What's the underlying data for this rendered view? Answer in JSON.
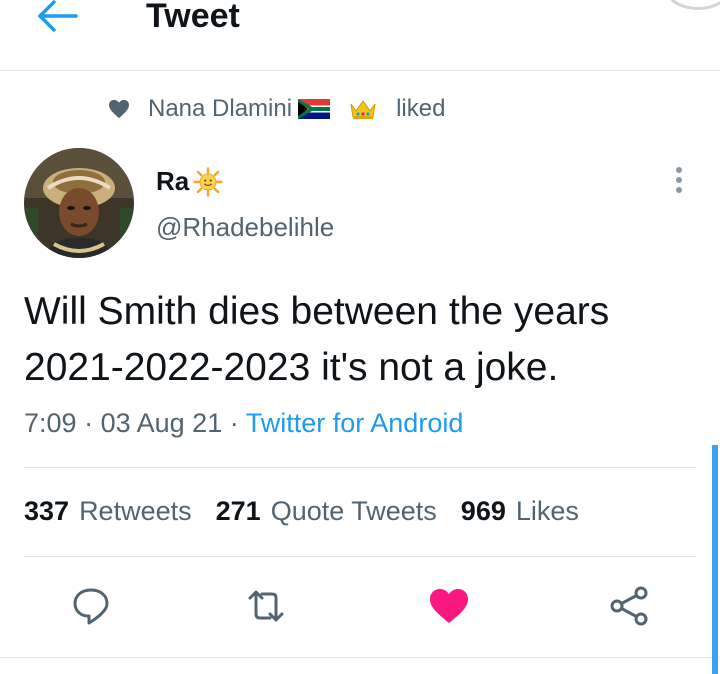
{
  "header": {
    "title": "Tweet"
  },
  "social_context": {
    "name": "Nana Dlamini",
    "action": "liked"
  },
  "tweet": {
    "author_name": "Ra",
    "author_handle": "@Rhadebelihle",
    "text_line1": "Will Smith dies between the years",
    "text_line2": "2021-2022-2023 it's not a joke.",
    "time": "7:09",
    "date": "03 Aug 21",
    "separator": "·",
    "source": "Twitter for Android"
  },
  "stats": {
    "retweets_count": "337",
    "retweets_label": "Retweets",
    "quotes_count": "271",
    "quotes_label": "Quote Tweets",
    "likes_count": "969",
    "likes_label": "Likes"
  },
  "icons": {
    "back": "arrow-left-icon",
    "heart_small": "heart-icon",
    "flag": "south-africa-flag-icon",
    "crown": "crown-emoji-icon",
    "sun": "sun-emoji-icon",
    "more": "more-vertical-icon",
    "reply": "reply-icon",
    "retweet": "retweet-icon",
    "like": "heart-icon",
    "share": "share-icon"
  },
  "colors": {
    "accent": "#1d9bf0",
    "like": "#f91880",
    "secondary_text": "#536471"
  }
}
